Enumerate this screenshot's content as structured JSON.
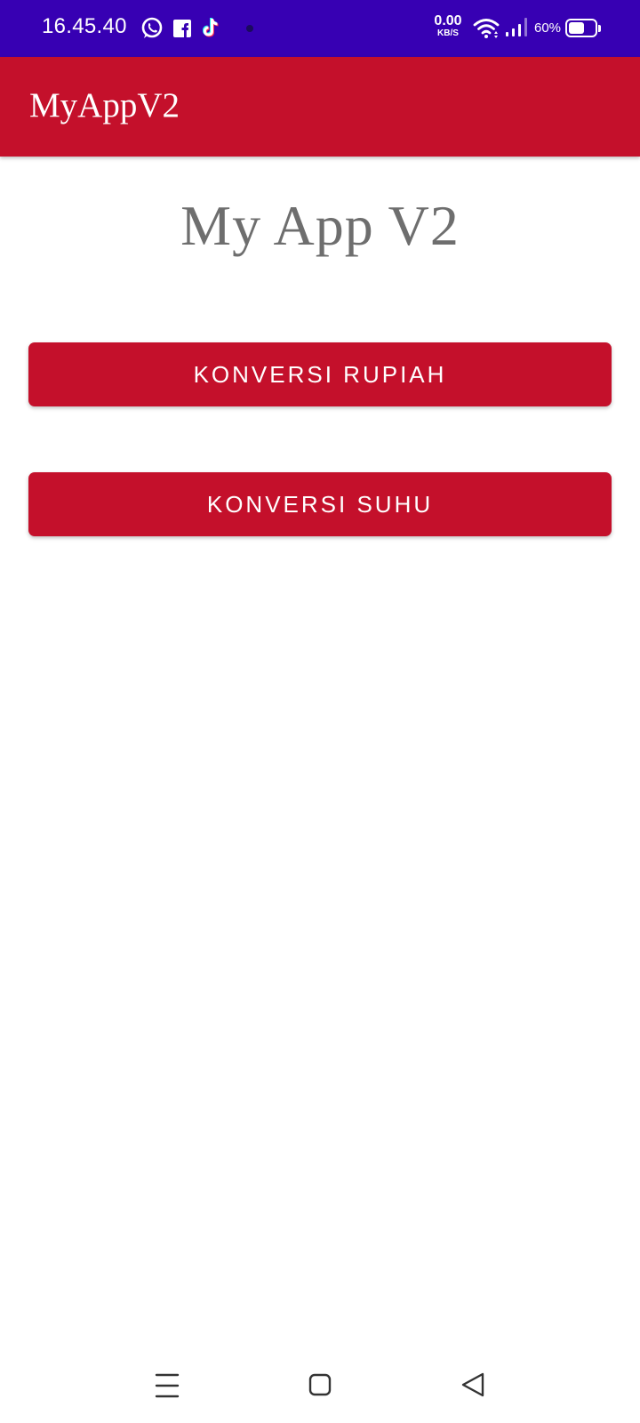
{
  "status_bar": {
    "time": "16.45.40",
    "net_speed_value": "0.00",
    "net_speed_unit": "KB/S",
    "battery_percent": "60%",
    "battery_level": 0.6,
    "notification_icons": [
      "whatsapp-icon",
      "facebook-icon",
      "tiktok-icon",
      "dot-icon"
    ],
    "system_icons": [
      "wifi-icon",
      "signal-icon",
      "battery-icon"
    ]
  },
  "app_bar": {
    "title": "MyAppV2",
    "color": "#c4102b"
  },
  "main": {
    "title": "My App V2",
    "buttons": [
      {
        "label": "KONVERSI RUPIAH"
      },
      {
        "label": "KONVERSI SUHU"
      }
    ]
  },
  "nav_bar": {
    "items": [
      "menu-icon",
      "home-icon",
      "back-icon"
    ]
  },
  "colors": {
    "status_bar": "#3700b3",
    "accent": "#c4102b",
    "title_text": "#6e6e6e"
  }
}
